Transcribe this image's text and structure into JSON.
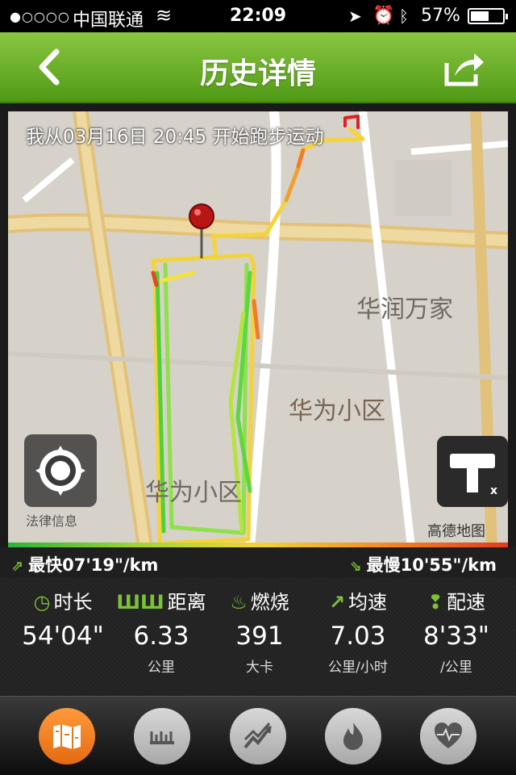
{
  "status_bar": {
    "signal": "●○○○○",
    "carrier": "中国联通",
    "time": "22:09",
    "battery": "57%",
    "battery_level": 0.57
  },
  "nav": {
    "title": "历史详情"
  },
  "map": {
    "caption": "我从03月16日 20:45 开始跑步运动",
    "poi_1": "华润万家",
    "poi_2": "华为小区",
    "poi_3": "华为小区",
    "legal_label": "法律信息",
    "provider": "高德地图"
  },
  "pace": {
    "fastest": "最快07'19\"/km",
    "slowest": "最慢10'55\"/km"
  },
  "stats": [
    {
      "label": "时长",
      "value": "54'04\"",
      "unit": ""
    },
    {
      "label": "距离",
      "value": "6.33",
      "unit": "公里"
    },
    {
      "label": "燃烧",
      "value": "391",
      "unit": "大卡"
    },
    {
      "label": "均速",
      "value": "7.03",
      "unit": "公里/小时"
    },
    {
      "label": "配速",
      "value": "8'33\"",
      "unit": "/公里"
    }
  ],
  "colors": {
    "accent": "#7bc234",
    "nav_green": "#5ea21f",
    "active_tab": "#f07e1f"
  }
}
